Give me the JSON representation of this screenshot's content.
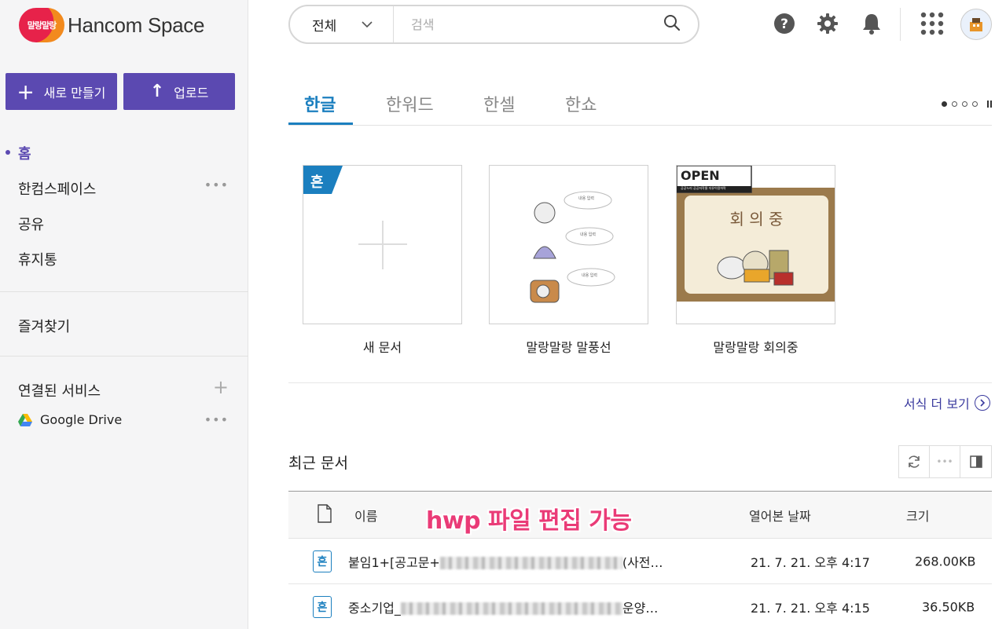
{
  "app": {
    "logo_badge": "말랑말랑",
    "logo_text": "Hancom Space"
  },
  "sidebar": {
    "new_button": "새로 만들기",
    "upload_button": "업로드",
    "items": [
      {
        "label": "홈"
      },
      {
        "label": "한컴스페이스"
      },
      {
        "label": "공유"
      },
      {
        "label": "휴지통"
      },
      {
        "label": "즐겨찾기"
      }
    ],
    "connected_services": "연결된 서비스",
    "google_drive": "Google Drive"
  },
  "search": {
    "category": "전체",
    "placeholder": "검색"
  },
  "tabs": [
    {
      "label": "한글"
    },
    {
      "label": "한워드"
    },
    {
      "label": "한셀"
    },
    {
      "label": "한쇼"
    }
  ],
  "templates": [
    {
      "label": "새 문서"
    },
    {
      "label": "말랑말랑 말풍선"
    },
    {
      "label": "말랑말랑 회의중"
    }
  ],
  "template_art": {
    "new_doc_badge": "흔",
    "bubble_text": "내용 입력",
    "open_logo": "OPEN",
    "open_sub": "공공누리  공공저작물 자유이용허락",
    "meeting_title": "회 의 중"
  },
  "more_templates": "서식 더 보기",
  "recent": {
    "title": "최근 문서",
    "columns": {
      "name": "이름",
      "opened": "열어본 날짜",
      "size": "크기"
    },
    "rows": [
      {
        "name_start": "붙임1+[공고문+",
        "name_end": "(사전…",
        "opened": "21. 7. 21. 오후 4:17",
        "size": "268.00KB"
      },
      {
        "name_start": "중소기업_",
        "name_end": "운양…",
        "opened": "21. 7. 21. 오후 4:15",
        "size": "36.50KB"
      }
    ]
  },
  "overlay_caption": "hwp 파일 편집 가능",
  "colors": {
    "brand_purple": "#5b49b1",
    "hangul_blue": "#1b7fbf",
    "caption_pink": "#ea3b77"
  }
}
